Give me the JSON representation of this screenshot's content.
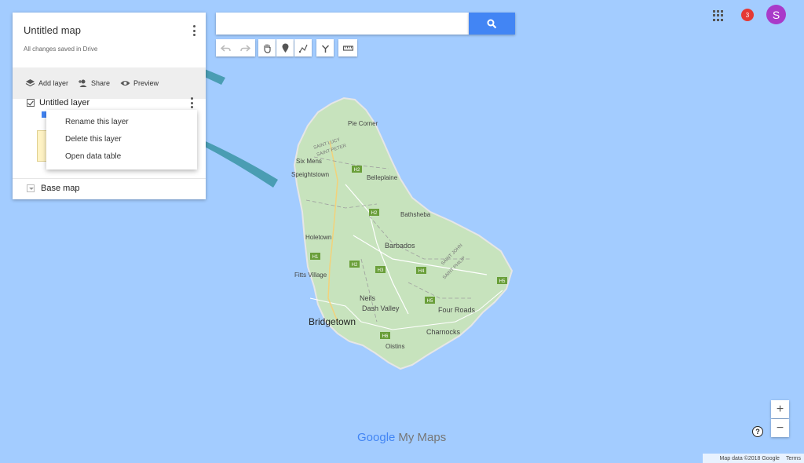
{
  "map": {
    "water_color": "#a3ccff",
    "land_color": "#c7e3bd",
    "place_labels": [
      "Pie Corner",
      "SAINT LUCY",
      "SAINT PETER",
      "Six Mens",
      "Speightstown",
      "Belleplaine",
      "Bathsheba",
      "Holetown",
      "Barbados",
      "SAINT JOHN",
      "SAINT PHILIP",
      "Fitts Village",
      "Neils",
      "Dash Valley",
      "Four Roads",
      "Bridgetown",
      "Charnocks",
      "Oistins"
    ],
    "road_shields": [
      "H2",
      "H2",
      "H1",
      "H2",
      "H3",
      "H4",
      "H5",
      "H5",
      "H6"
    ]
  },
  "panel": {
    "title": "Untitled map",
    "subtitle": "All changes saved in Drive",
    "actions": {
      "add_layer": "Add layer",
      "share": "Share",
      "preview": "Preview"
    },
    "layer_name": "Untitled layer",
    "base_map": "Base map"
  },
  "context_menu": {
    "items": [
      "Rename this layer",
      "Delete this layer",
      "Open data table"
    ]
  },
  "search": {
    "placeholder": ""
  },
  "toolbar": {
    "tools": [
      "undo-icon",
      "redo-icon",
      "hand-icon",
      "marker-icon",
      "draw-line-icon",
      "directions-icon",
      "ruler-icon"
    ]
  },
  "header": {
    "notifications_count": "3",
    "avatar_letter": "S"
  },
  "zoom": {
    "in": "+",
    "out": "−"
  },
  "help": "?",
  "branding": {
    "google": "Google",
    "product": "My Maps"
  },
  "attribution": {
    "data": "Map data ©2018 Google",
    "terms": "Terms"
  },
  "colors": {
    "accent": "#4285f4",
    "arrow": "#4a9db3",
    "badge": "#e53935",
    "avatar": "#a93ac9"
  }
}
